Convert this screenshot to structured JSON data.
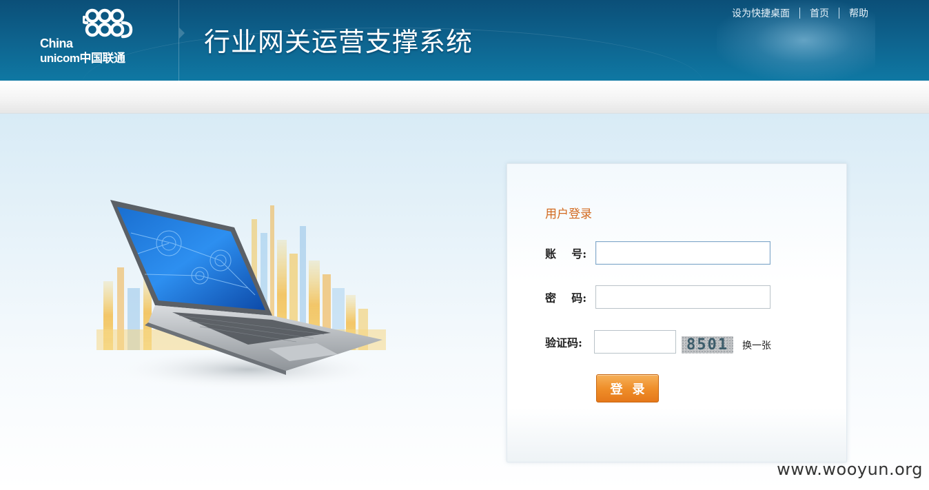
{
  "header": {
    "brand_line1": "China",
    "brand_line2": "unicom中国联通",
    "system_title": "行业网关运营支撑系统",
    "links": [
      "设为快捷桌面",
      "首页",
      "帮助"
    ]
  },
  "login": {
    "title": "用户登录",
    "account_label": "账    号:",
    "password_label": "密    码:",
    "captcha_label": "验证码:",
    "account_value": "",
    "password_value": "",
    "captcha_value": "",
    "captcha_image_text": "8501",
    "refresh_label": "换一张",
    "submit_label": "登录"
  },
  "watermark": "www.wooyun.org",
  "colors": {
    "header_bg": "#0e6590",
    "panel_title": "#d2691e",
    "button_orange": "#ef8f2a",
    "page_bg": "#e6f2f9"
  }
}
